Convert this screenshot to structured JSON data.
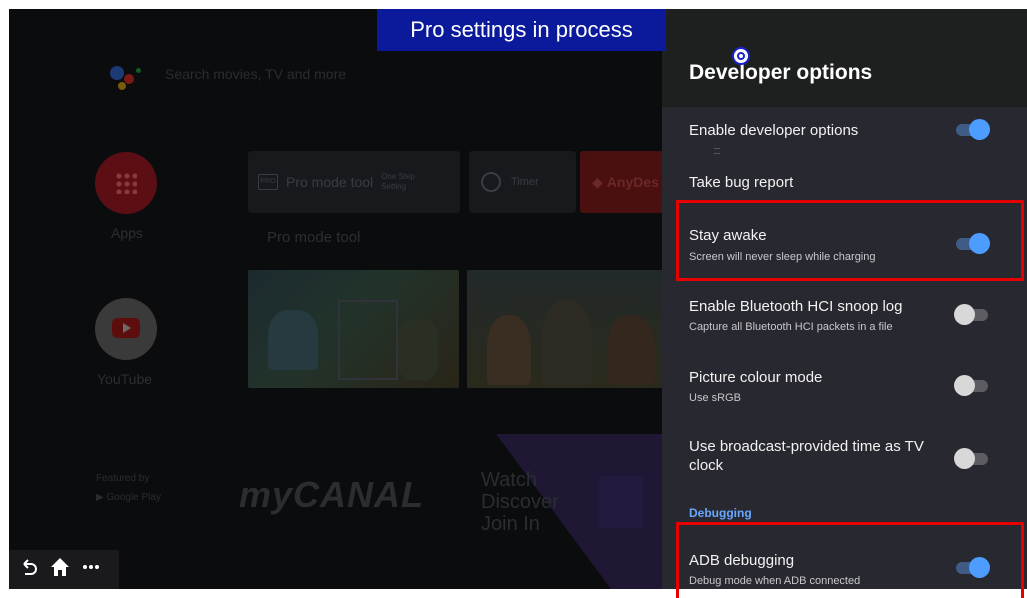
{
  "overlay": {
    "title": "Pro settings in process"
  },
  "launcher": {
    "search_placeholder": "Search movies, TV and more",
    "apps_label": "Apps",
    "youtube_label": "YouTube",
    "pro_mode_tool": "Pro mode tool",
    "pro_mode_tool_caption": "Pro mode tool",
    "one_step_setting_line1": "One Step",
    "one_step_setting_line2": "Setting",
    "timer": "Timer",
    "anydesk": "AnyDes",
    "featured_by": "Featured by",
    "google_play": "Google Play",
    "mycanal": "myCANAL",
    "twitch_lines": [
      "Watch",
      "Discover",
      "Join In"
    ]
  },
  "navbar": {
    "back": "back-icon",
    "home": "home-icon",
    "more": "more-icon"
  },
  "panel": {
    "title": "Developer options",
    "rows": [
      {
        "title": "Enable developer options",
        "subtitle": "",
        "toggle": true
      },
      {
        "title": "Take bug report",
        "subtitle": ""
      },
      {
        "title": "Stay awake",
        "subtitle": "Screen will never sleep while charging",
        "toggle": true
      },
      {
        "title": "Enable Bluetooth HCI snoop log",
        "subtitle": "Capture all Bluetooth HCI packets in a file",
        "toggle": false
      },
      {
        "title": "Picture colour mode",
        "subtitle": "Use sRGB",
        "toggle": false
      },
      {
        "title": "Use broadcast-provided time as TV clock",
        "subtitle": "",
        "toggle": false
      }
    ],
    "section_debugging": "Debugging",
    "adb": {
      "title": "ADB debugging",
      "subtitle": "Debug mode when ADB connected",
      "toggle": true
    }
  },
  "colors": {
    "accent_toggle": "#4d9cff",
    "highlight": "#e60000",
    "overlay_bg": "#0a1a9a",
    "panel_bg": "#282830"
  }
}
